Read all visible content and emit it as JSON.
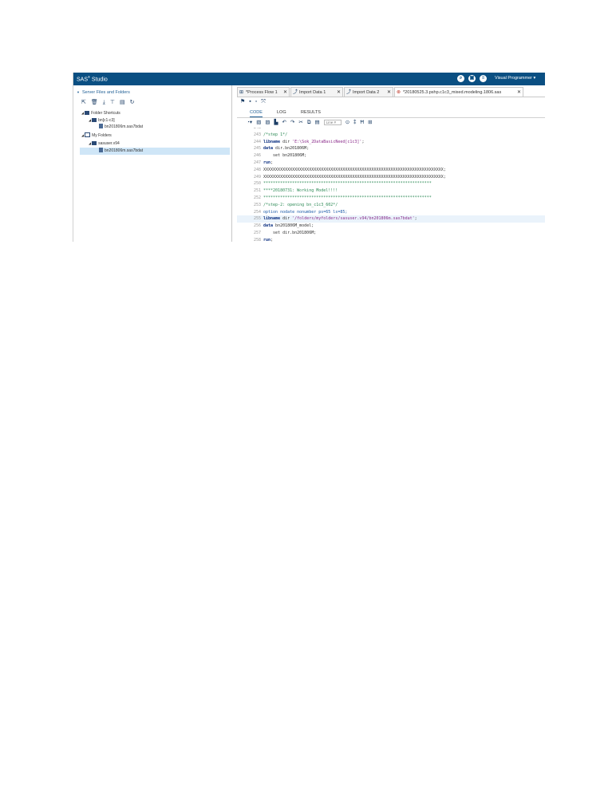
{
  "app": {
    "title": "SAS",
    "title_sup": "®",
    "title_rest": " Studio",
    "mode": "Visual Programmer ▾",
    "accent_color": "#0a4f82"
  },
  "left_pane": {
    "header": "Server Files and Folders",
    "tree": [
      {
        "label": "Folder Shortcuts",
        "icon": "folder-shortcut-icon"
      },
      {
        "label": "bn[c1-c3]",
        "icon": "folder-shortcut-icon"
      },
      {
        "label": "bn201806m.sas7bdat",
        "icon": "dataset-icon"
      },
      {
        "label": "My Folders",
        "icon": "my-folders-icon"
      },
      {
        "label": "sasuser.v94",
        "icon": "folder-icon"
      },
      {
        "label": "bn201806m.sas7bdat",
        "icon": "dataset-icon"
      }
    ]
  },
  "tabs": [
    {
      "label": "*Process Flow 1"
    },
    {
      "label": "Import Data 1"
    },
    {
      "label": "Import Data 2"
    },
    {
      "label": "*20180525.3.pshp.c1c3_mixed.modeling.1806.sas"
    }
  ],
  "subtabs": [
    "CODE",
    "LOG",
    "RESULTS"
  ],
  "editor": {
    "line_placeholder": "Line #"
  },
  "code_lines": [
    {
      "n": "243",
      "parts": []
    },
    {
      "n": "243",
      "parts": [
        {
          "c": "t-comment",
          "t": "/*step 1*/"
        }
      ]
    },
    {
      "n": "244",
      "parts": [
        {
          "c": "t-kw",
          "t": "libname"
        },
        {
          "c": "t-plain",
          "t": " dir "
        },
        {
          "c": "t-str",
          "t": "'E:\\Sok_2DataBasicNeed[c1c3]'"
        },
        {
          "c": "t-plain",
          "t": ";"
        }
      ]
    },
    {
      "n": "245",
      "parts": [
        {
          "c": "t-kw",
          "t": "data"
        },
        {
          "c": "t-plain",
          "t": " dir.bn201806M;"
        }
      ]
    },
    {
      "n": "246",
      "parts": [
        {
          "c": "t-plain",
          "t": "    set bn201806M;"
        }
      ]
    },
    {
      "n": "247",
      "parts": [
        {
          "c": "t-kw",
          "t": "run"
        },
        {
          "c": "t-plain",
          "t": ";"
        }
      ]
    },
    {
      "n": "248",
      "parts": [
        {
          "c": "t-plain",
          "t": "XXXXXXXXXXXXXXXXXXXXXXXXXXXXXXXXXXXXXXXXXXXXXXXXXXXXXXXXXXXXXXXXXXXXXXXXXXX;"
        }
      ]
    },
    {
      "n": "249",
      "parts": [
        {
          "c": "t-plain",
          "t": "XXXXXXXXXXXXXXXXXXXXXXXXXXXXXXXXXXXXXXXXXXXXXXXXXXXXXXXXXXXXXXXXXXXXXXXXXXX;"
        }
      ]
    },
    {
      "n": "250",
      "parts": [
        {
          "c": "t-comment",
          "t": "**********************************************************************"
        }
      ]
    },
    {
      "n": "251",
      "parts": [
        {
          "c": "t-comment",
          "t": "****20180731: Working Model!!!!"
        }
      ]
    },
    {
      "n": "252",
      "parts": [
        {
          "c": "t-comment",
          "t": "**********************************************************************"
        }
      ]
    },
    {
      "n": "253",
      "parts": [
        {
          "c": "t-comment",
          "t": "/*step-2: opening bn_c1c3_602*/"
        }
      ]
    },
    {
      "n": "254",
      "parts": [
        {
          "c": "t-blue",
          "t": "option nodate nonumber ps=65 ls=85;"
        }
      ]
    },
    {
      "n": "255",
      "parts": [
        {
          "c": "t-kw",
          "t": "libname"
        },
        {
          "c": "t-plain",
          "t": " dir "
        },
        {
          "c": "t-str",
          "t": "'/folders/myfolders/sasuser.v94/bn201806m.sas7bdat'"
        },
        {
          "c": "t-plain",
          "t": ";"
        }
      ],
      "current": true
    },
    {
      "n": "256",
      "parts": [
        {
          "c": "t-kw",
          "t": "data"
        },
        {
          "c": "t-plain",
          "t": " bn201806M_model;"
        }
      ]
    },
    {
      "n": "257",
      "parts": [
        {
          "c": "t-plain",
          "t": "    set dir.bn201806M;"
        }
      ]
    },
    {
      "n": "258",
      "parts": [
        {
          "c": "t-kw",
          "t": "run"
        },
        {
          "c": "t-plain",
          "t": ";"
        }
      ]
    },
    {
      "n": "259",
      "parts": []
    }
  ]
}
